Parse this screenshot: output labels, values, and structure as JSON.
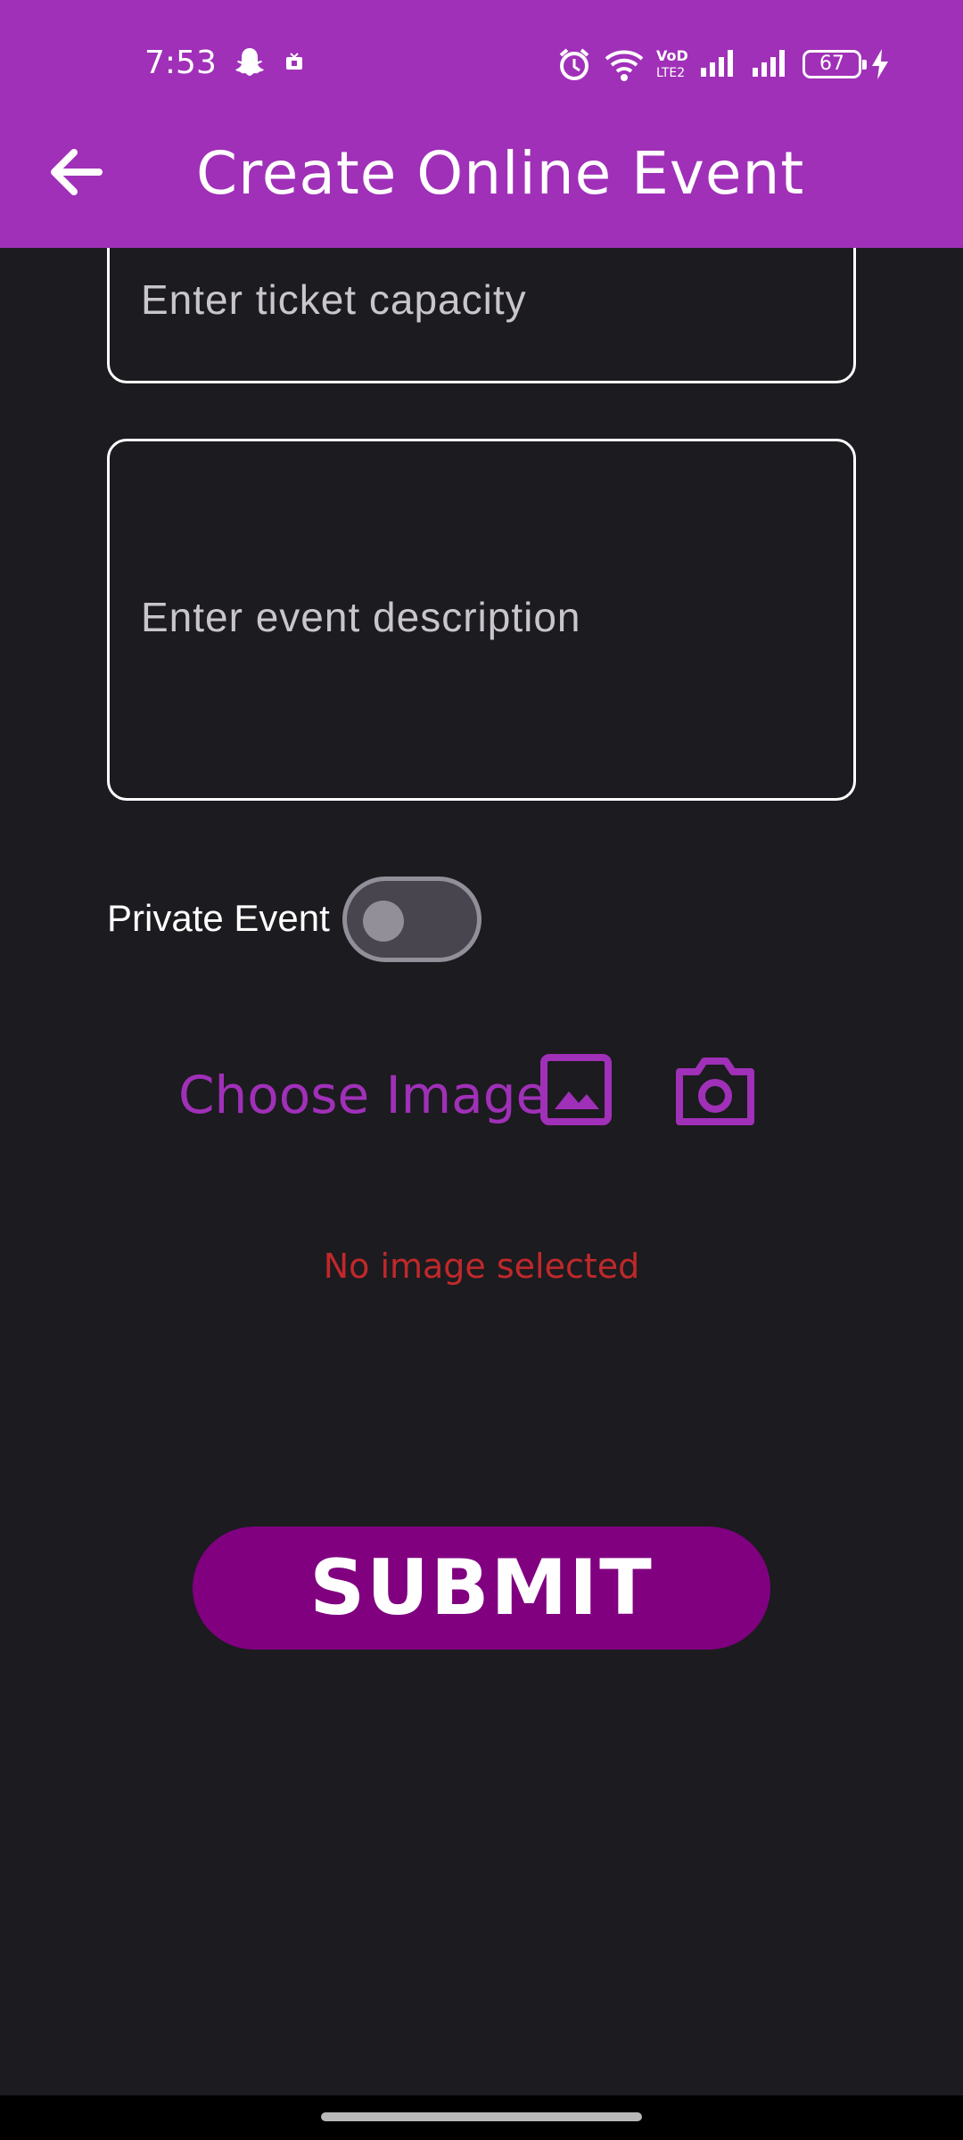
{
  "status_bar": {
    "time": "7:53",
    "battery": "67",
    "icons": [
      "snapchat-icon",
      "notification-icon",
      "alarm-icon",
      "wifi-icon",
      "volte-icon",
      "signal-icon",
      "signal-icon",
      "battery-icon",
      "charging-icon"
    ]
  },
  "app_bar": {
    "title": "Create Online Event",
    "back_icon": "arrow-back-icon"
  },
  "form": {
    "ticket_capacity": {
      "value": "",
      "placeholder": "Enter ticket capacity"
    },
    "event_description": {
      "value": "",
      "placeholder": "Enter event description"
    },
    "private_event": {
      "label": "Private Event",
      "checked": false
    },
    "image": {
      "label": "Choose Image",
      "gallery_icon": "image-icon",
      "camera_icon": "camera-icon",
      "status": "No image selected"
    },
    "submit_label": "SUBMIT"
  },
  "colors": {
    "app_bar": "#a030b8",
    "background": "#1c1b1f",
    "accent": "#a030b8",
    "submit": "#800080",
    "error": "#c0282b"
  }
}
